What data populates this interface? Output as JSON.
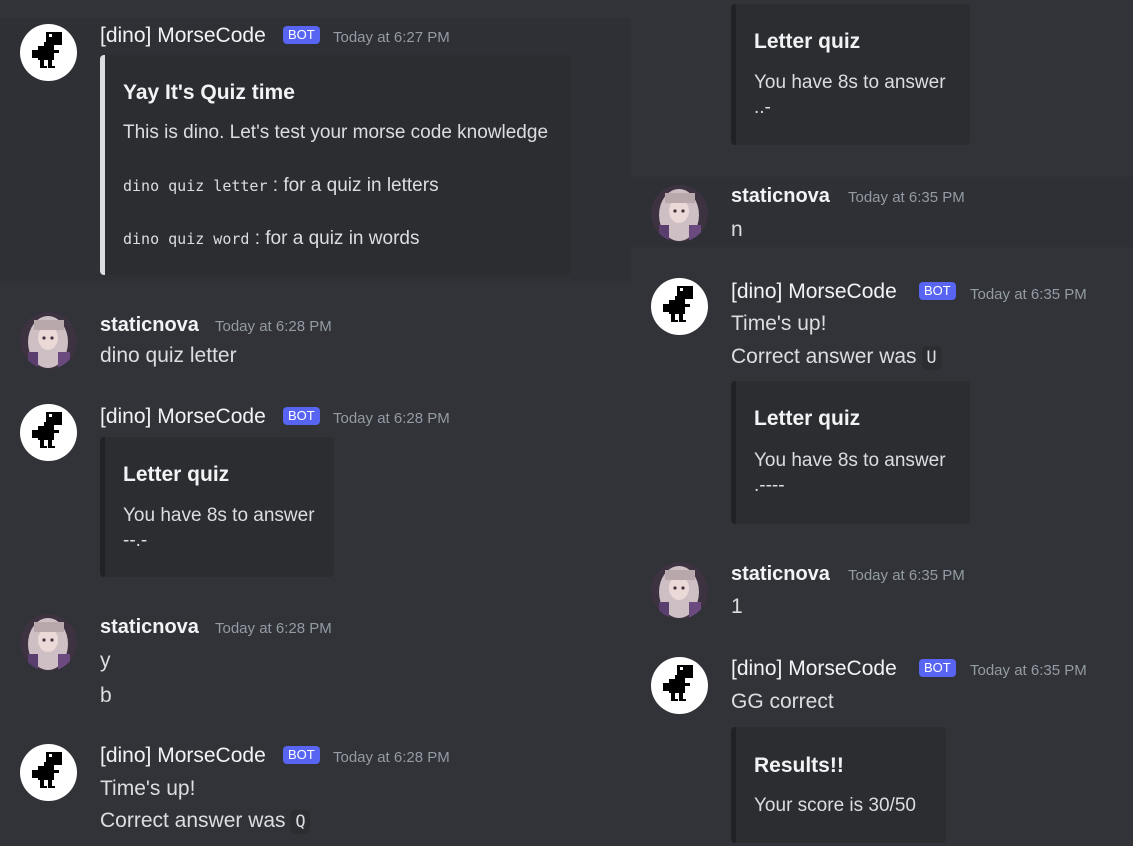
{
  "colors": {
    "background": "#313338",
    "embed_bg": "#2b2d31",
    "bot_badge": "#5865f2",
    "timestamp": "#949ba4"
  },
  "left": {
    "m1": {
      "username": "[dino] MorseCode",
      "badge": "BOT",
      "timestamp": "Today at 6:27 PM",
      "embed": {
        "title": "Yay It's Quiz time",
        "desc": "This is dino. Let's test your morse code knowledge",
        "cmd1": "dino quiz letter",
        "cmd1_text": ": for a quiz in letters",
        "cmd2": "dino quiz word",
        "cmd2_text": ": for a quiz in words"
      }
    },
    "m2": {
      "username": "staticnova",
      "timestamp": "Today at 6:28 PM",
      "text": "dino quiz letter"
    },
    "m3": {
      "username": "[dino] MorseCode",
      "badge": "BOT",
      "timestamp": "Today at 6:28 PM",
      "embed": {
        "title": "Letter quiz",
        "line1": "You have 8s to answer",
        "line2": "--.-"
      }
    },
    "m4": {
      "username": "staticnova",
      "timestamp": "Today at 6:28 PM",
      "line1": "y",
      "line2": "b"
    },
    "m5": {
      "username": "[dino] MorseCode",
      "badge": "BOT",
      "timestamp": "Today at 6:28 PM",
      "line1": "Time's up!",
      "line2_prefix": "Correct answer was",
      "answer": "Q"
    }
  },
  "right": {
    "m0": {
      "embed": {
        "title": "Letter quiz",
        "line1": "You have 8s to answer",
        "line2": "..-"
      }
    },
    "m1": {
      "username": "staticnova",
      "timestamp": "Today at 6:35 PM",
      "text": "n"
    },
    "m2": {
      "username": "[dino] MorseCode",
      "badge": "BOT",
      "timestamp": "Today at 6:35 PM",
      "line1": "Time's up!",
      "line2_prefix": "Correct answer was",
      "answer": "U",
      "embed": {
        "title": "Letter quiz",
        "line1": "You have 8s to answer",
        "line2": ".----"
      }
    },
    "m3": {
      "username": "staticnova",
      "timestamp": "Today at 6:35 PM",
      "text": "1"
    },
    "m4": {
      "username": "[dino] MorseCode",
      "badge": "BOT",
      "timestamp": "Today at 6:35 PM",
      "text": "GG correct",
      "embed": {
        "title": "Results!!",
        "line1": "Your score is 30/50"
      }
    }
  }
}
